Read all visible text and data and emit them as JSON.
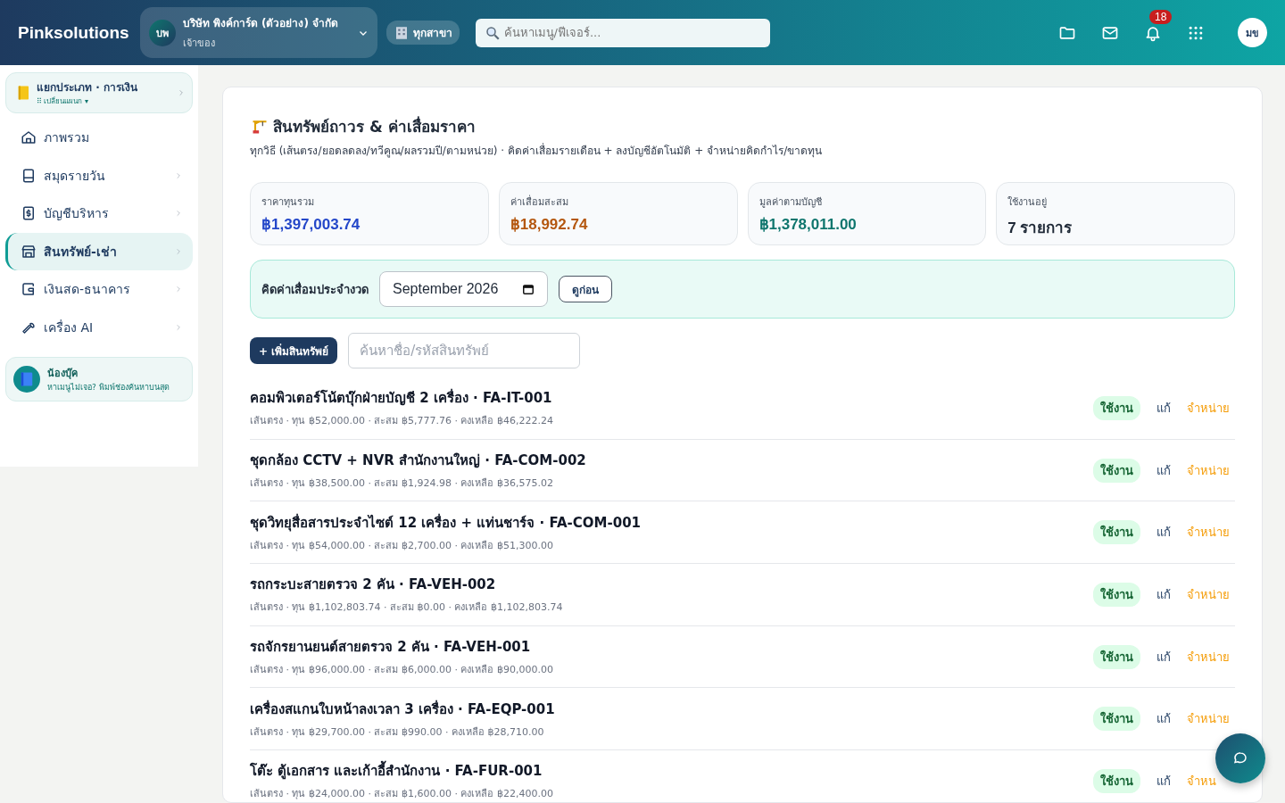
{
  "topbar": {
    "brand": "Pinksolutions",
    "company": {
      "initials": "บพ",
      "name": "บริษัท พิงค์การ์ด (ตัวอย่าง) จำกัด",
      "role": "เจ้าของ"
    },
    "branch": "ทุกสาขา",
    "search": {
      "placeholder": "ค้นหาเมนู/ฟีเจอร์..."
    },
    "notifications": "18",
    "user": "มข"
  },
  "sidebar": {
    "department": {
      "title": "แยกประเภท · การเงิน",
      "switch": "⠿ เปลี่ยนแผนก ▾"
    },
    "items": [
      {
        "label": "ภาพรวม",
        "chevron": false,
        "selected": false
      },
      {
        "label": "สมุดรายวัน",
        "chevron": true,
        "selected": false
      },
      {
        "label": "บัญชีบริหาร",
        "chevron": true,
        "selected": false
      },
      {
        "label": "สินทรัพย์-เช่า",
        "chevron": true,
        "selected": true
      },
      {
        "label": "เงินสด-ธนาคาร",
        "chevron": true,
        "selected": false
      },
      {
        "label": "เครื่อง AI",
        "chevron": true,
        "selected": false
      }
    ],
    "helper": {
      "title": "น้องบุ๊ค",
      "text": "หาเมนูไม่เจอ? พิมพ์ช่องค้นหาบนสุด"
    }
  },
  "page": {
    "title": "สินทรัพย์ถาวร & ค่าเสื่อมราคา",
    "subtitle": "ทุกวิธี (เส้นตรง/ยอดลดลง/ทวีคูณ/ผลรวมปี/ตามหน่วย) · คิดค่าเสื่อมรายเดือน + ลงบัญชีอัตโนมัติ + จำหน่ายคิดกำไร/ขาดทุน",
    "stats": [
      {
        "label": "ราคาทุนรวม",
        "value": "฿1,397,003.74",
        "color": "#2447c9"
      },
      {
        "label": "ค่าเสื่อมสะสม",
        "value": "฿18,992.74",
        "color": "#b4570f"
      },
      {
        "label": "มูลค่าตามบัญชี",
        "value": "฿1,378,011.00",
        "color": "#0f766e"
      },
      {
        "label": "ใช้งานอยู่",
        "value": "7 รายการ",
        "color": "#1f2937"
      }
    ],
    "depreciation": {
      "label": "คิดค่าเสื่อมประจำงวด",
      "month": "September 2026",
      "preview": "ดูก่อน"
    },
    "add_button": "+ เพิ่มสินทรัพย์",
    "asset_search": {
      "placeholder": "ค้นหาชื่อ/รหัสสินทรัพย์"
    },
    "assets": [
      {
        "title": "คอมพิวเตอร์โน้ตบุ๊กฝ่ายบัญชี 2 เครื่อง · FA-IT-001",
        "meta": "เส้นตรง · ทุน ฿52,000.00 · สะสม ฿5,777.76 · คงเหลือ ฿46,222.24",
        "status": "ใช้งาน",
        "edit": "แก้",
        "dispose": "จำหน่าย"
      },
      {
        "title": "ชุดกล้อง CCTV + NVR สำนักงานใหญ่ · FA-COM-002",
        "meta": "เส้นตรง · ทุน ฿38,500.00 · สะสม ฿1,924.98 · คงเหลือ ฿36,575.02",
        "status": "ใช้งาน",
        "edit": "แก้",
        "dispose": "จำหน่าย"
      },
      {
        "title": "ชุดวิทยุสื่อสารประจำไซต์ 12 เครื่อง + แท่นชาร์จ · FA-COM-001",
        "meta": "เส้นตรง · ทุน ฿54,000.00 · สะสม ฿2,700.00 · คงเหลือ ฿51,300.00",
        "status": "ใช้งาน",
        "edit": "แก้",
        "dispose": "จำหน่าย"
      },
      {
        "title": "รถกระบะสายตรวจ 2 คัน · FA-VEH-002",
        "meta": "เส้นตรง · ทุน ฿1,102,803.74 · สะสม ฿0.00 · คงเหลือ ฿1,102,803.74",
        "status": "ใช้งาน",
        "edit": "แก้",
        "dispose": "จำหน่าย"
      },
      {
        "title": "รถจักรยานยนต์สายตรวจ 2 คัน · FA-VEH-001",
        "meta": "เส้นตรง · ทุน ฿96,000.00 · สะสม ฿6,000.00 · คงเหลือ ฿90,000.00",
        "status": "ใช้งาน",
        "edit": "แก้",
        "dispose": "จำหน่าย"
      },
      {
        "title": "เครื่องสแกนใบหน้าลงเวลา 3 เครื่อง · FA-EQP-001",
        "meta": "เส้นตรง · ทุน ฿29,700.00 · สะสม ฿990.00 · คงเหลือ ฿28,710.00",
        "status": "ใช้งาน",
        "edit": "แก้",
        "dispose": "จำหน่าย"
      },
      {
        "title": "โต๊ะ ตู้เอกสาร และเก้าอี้สำนักงาน · FA-FUR-001",
        "meta": "เส้นตรง · ทุน ฿24,000.00 · สะสม ฿1,600.00 · คงเหลือ ฿22,400.00",
        "status": "ใช้งาน",
        "edit": "แก้",
        "dispose": "จำหน"
      }
    ]
  }
}
